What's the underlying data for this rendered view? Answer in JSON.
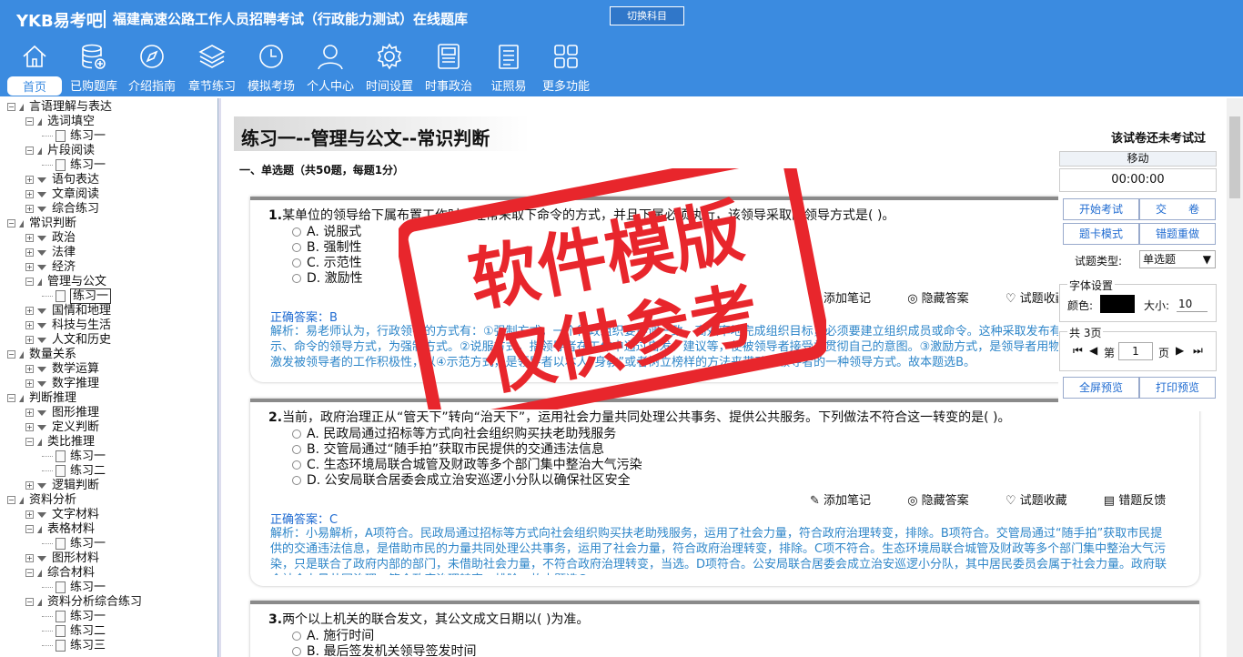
{
  "header": {
    "logo": "YKB易考吧",
    "title": "福建高速公路工作人员招聘考试（行政能力测试）在线题库",
    "switch_subject": "切换科目"
  },
  "nav": [
    {
      "label": "首页",
      "icon": "home-icon",
      "active": true
    },
    {
      "label": "已购题库",
      "icon": "database-icon"
    },
    {
      "label": "介绍指南",
      "icon": "compass-icon"
    },
    {
      "label": "章节练习",
      "icon": "layers-icon"
    },
    {
      "label": "模拟考场",
      "icon": "clock-icon"
    },
    {
      "label": "个人中心",
      "icon": "user-icon"
    },
    {
      "label": "时间设置",
      "icon": "gear-icon"
    },
    {
      "label": "时事政治",
      "icon": "news-icon"
    },
    {
      "label": "证照易",
      "icon": "clipboard-icon"
    },
    {
      "label": "更多功能",
      "icon": "grid-icon"
    }
  ],
  "tree": [
    {
      "label": "言语理解与表达",
      "level": 0,
      "open": true
    },
    {
      "label": "选词填空",
      "level": 1,
      "open": true
    },
    {
      "label": "练习一",
      "level": 2,
      "leaf": true
    },
    {
      "label": "片段阅读",
      "level": 1,
      "open": true
    },
    {
      "label": "练习一",
      "level": 2,
      "leaf": true
    },
    {
      "label": "语句表达",
      "level": 1
    },
    {
      "label": "文章阅读",
      "level": 1
    },
    {
      "label": "综合练习",
      "level": 1
    },
    {
      "label": "常识判断",
      "level": 0,
      "open": true
    },
    {
      "label": "政治",
      "level": 1
    },
    {
      "label": "法律",
      "level": 1
    },
    {
      "label": "经济",
      "level": 1
    },
    {
      "label": "管理与公文",
      "level": 1,
      "open": true
    },
    {
      "label": "练习一",
      "level": 2,
      "leaf": true,
      "selected": true
    },
    {
      "label": "国情和地理",
      "level": 1
    },
    {
      "label": "科技与生活",
      "level": 1
    },
    {
      "label": "人文和历史",
      "level": 1
    },
    {
      "label": "数量关系",
      "level": 0,
      "open": true
    },
    {
      "label": "数学运算",
      "level": 1
    },
    {
      "label": "数字推理",
      "level": 1
    },
    {
      "label": "判断推理",
      "level": 0,
      "open": true
    },
    {
      "label": "图形推理",
      "level": 1
    },
    {
      "label": "定义判断",
      "level": 1
    },
    {
      "label": "类比推理",
      "level": 1,
      "open": true
    },
    {
      "label": "练习一",
      "level": 2,
      "leaf": true
    },
    {
      "label": "练习二",
      "level": 2,
      "leaf": true
    },
    {
      "label": "逻辑判断",
      "level": 1
    },
    {
      "label": "资料分析",
      "level": 0,
      "open": true
    },
    {
      "label": "文字材料",
      "level": 1
    },
    {
      "label": "表格材料",
      "level": 1,
      "open": true
    },
    {
      "label": "练习一",
      "level": 2,
      "leaf": true
    },
    {
      "label": "图形材料",
      "level": 1
    },
    {
      "label": "综合材料",
      "level": 1,
      "open": true
    },
    {
      "label": "练习一",
      "level": 2,
      "leaf": true
    },
    {
      "label": "资料分析综合练习",
      "level": 1,
      "open": true
    },
    {
      "label": "练习一",
      "level": 2,
      "leaf": true
    },
    {
      "label": "练习二",
      "level": 2,
      "leaf": true
    },
    {
      "label": "练习三",
      "level": 2,
      "leaf": true
    }
  ],
  "paper": {
    "title": "练习一--管理与公文--常识判断",
    "status": "该试卷还未考试过",
    "section": "一、单选题（共50题，每题1分）"
  },
  "questions": [
    {
      "num": "1.",
      "text": "某单位的领导给下属布置工作时，经常采取下命令的方式，并且下属必须执行，该领导采取的领导方式是(  )。",
      "options": [
        "A. 说服式",
        "B. 强制性",
        "C. 示范性",
        "D. 激励性"
      ],
      "answer": "正确答案：B",
      "explanation": "解析：易老师认为，行政领导的方式有：①强制方式，一个行政组织要协调一致、高效率地完成组织目标，必须要建立组织成员或命令。这种采取发布有权威性、强制性的指示、命令的领导方式，为强制方式。②说服方式，指领导者在工作中通过启发、建议等，使被领导者接受并贯彻自己的意图。③激励方式，是领导者用物质或精神鼓励的手段激发被领导者的工作积极性，以④示范方式，是领导者以本人“身教”或者树立榜样的方法来带动被领导者的一种领导方式。故本题选B。"
    },
    {
      "num": "2.",
      "text": "当前，政府治理正从“管天下”转向“治天下”，运用社会力量共同处理公共事务、提供公共服务。下列做法不符合这一转变的是(  )。",
      "options": [
        "A. 民政局通过招标等方式向社会组织购买扶老助残服务",
        "B. 交管局通过“随手拍”获取市民提供的交通违法信息",
        "C. 生态环境局联合城管及财政等多个部门集中整治大气污染",
        "D. 公安局联合居委会成立治安巡逻小分队以确保社区安全"
      ],
      "answer": "正确答案：C",
      "explanation": "解析：小易解析，A项符合。民政局通过招标等方式向社会组织购买扶老助残服务，运用了社会力量，符合政府治理转变，排除。B项符合。交管局通过“随手拍”获取市民提供的交通违法信息，是借助市民的力量共同处理公共事务，运用了社会力量，符合政府治理转变，排除。C项不符合。生态环境局联合城管及财政等多个部门集中整治大气污染，只是联合了政府内部的部门，未借助社会力量，不符合政府治理转变，当选。D项符合。公安局联合居委会成立治安巡逻小分队，其中居民委员会属于社会力量。政府联合社会力量共同治理，符合政府治理转变，排除。故本题选C。"
    },
    {
      "num": "3.",
      "text": "两个以上机关的联合发文，其公文成文日期以(  )为准。",
      "options": [
        "A. 施行时间",
        "B. 最后签发机关领导签发时间"
      ]
    }
  ],
  "actions": {
    "add_note": "添加笔记",
    "hide_answer": "隐藏答案",
    "favorite": "试题收藏",
    "feedback": "错题反馈"
  },
  "panel": {
    "move": "移动",
    "timer": "00:00:00",
    "start_exam": "开始考试",
    "submit": "交　　卷",
    "card_mode": "题卡模式",
    "wrong_redo": "错题重做",
    "type_label": "试题类型:",
    "type_value": "单选题",
    "font_settings": "字体设置",
    "color_label": "颜色:",
    "size_label": "大小:",
    "size_value": "10",
    "pages": "共 3页",
    "page_prefix": "第",
    "page_value": "1",
    "page_suffix": "页",
    "fullscreen": "全屏预览",
    "print": "打印预览"
  },
  "stamp": {
    "line1": "软件模版",
    "line2": "仅供参考",
    "color": "#e8262c"
  }
}
